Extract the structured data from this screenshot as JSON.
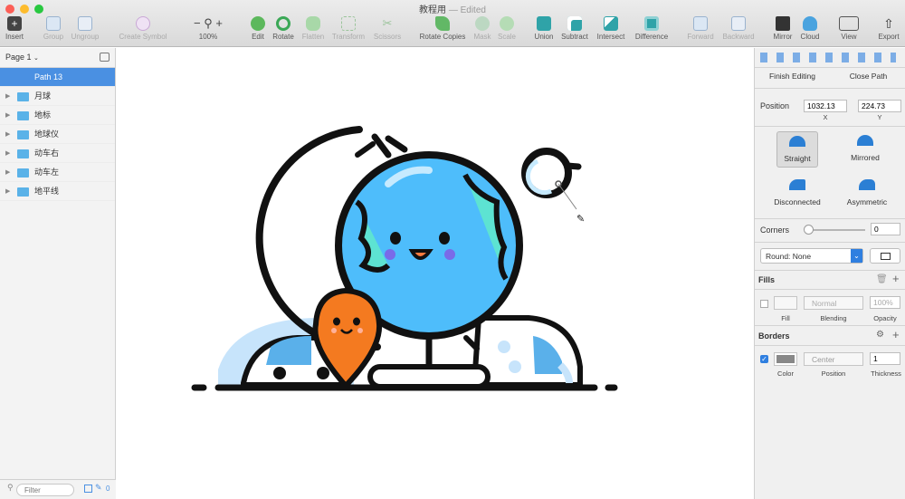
{
  "window": {
    "title": "教程用",
    "status": "— Edited"
  },
  "toolbar": {
    "insert": "Insert",
    "group": "Group",
    "ungroup": "Ungroup",
    "create_symbol": "Create Symbol",
    "zoom_minus": "−",
    "zoom_plus": "+",
    "zoom_value": "100%",
    "edit": "Edit",
    "rotate": "Rotate",
    "flatten": "Flatten",
    "transform": "Transform",
    "scissors": "Scissors",
    "rotate_copies": "Rotate Copies",
    "mask": "Mask",
    "scale": "Scale",
    "union": "Union",
    "subtract": "Subtract",
    "intersect": "Intersect",
    "difference": "Difference",
    "forward": "Forward",
    "backward": "Backward",
    "mirror": "Mirror",
    "cloud": "Cloud",
    "view": "View",
    "export": "Export"
  },
  "sidebar": {
    "page": "Page 1",
    "layers": [
      {
        "label": "Path 13",
        "selected": true
      },
      {
        "label": "月球"
      },
      {
        "label": "地标"
      },
      {
        "label": "地球仪"
      },
      {
        "label": "动车右"
      },
      {
        "label": "动车左"
      },
      {
        "label": "地平线"
      }
    ],
    "filter_placeholder": "Filter",
    "filter_count": "0"
  },
  "inspector": {
    "finish_editing": "Finish Editing",
    "close_path": "Close Path",
    "position_label": "Position",
    "x_value": "1032.13",
    "y_value": "224.73",
    "x_label": "X",
    "y_label": "Y",
    "point_types": [
      "Straight",
      "Mirrored",
      "Disconnected",
      "Asymmetric"
    ],
    "corners_label": "Corners",
    "corners_value": "0",
    "round_select": "Round: None",
    "fills": {
      "title": "Fills",
      "blending": "Normal",
      "opacity": "100%",
      "fill_label": "Fill",
      "blending_label": "Blending",
      "opacity_label": "Opacity"
    },
    "borders": {
      "title": "Borders",
      "position": "Center",
      "thickness": "1",
      "color_label": "Color",
      "position_label": "Position",
      "thickness_label": "Thickness"
    }
  },
  "colors": {
    "accent": "#4a90e2",
    "globe": "#4ebdfb",
    "pin": "#f47a20",
    "outline": "#111111"
  }
}
